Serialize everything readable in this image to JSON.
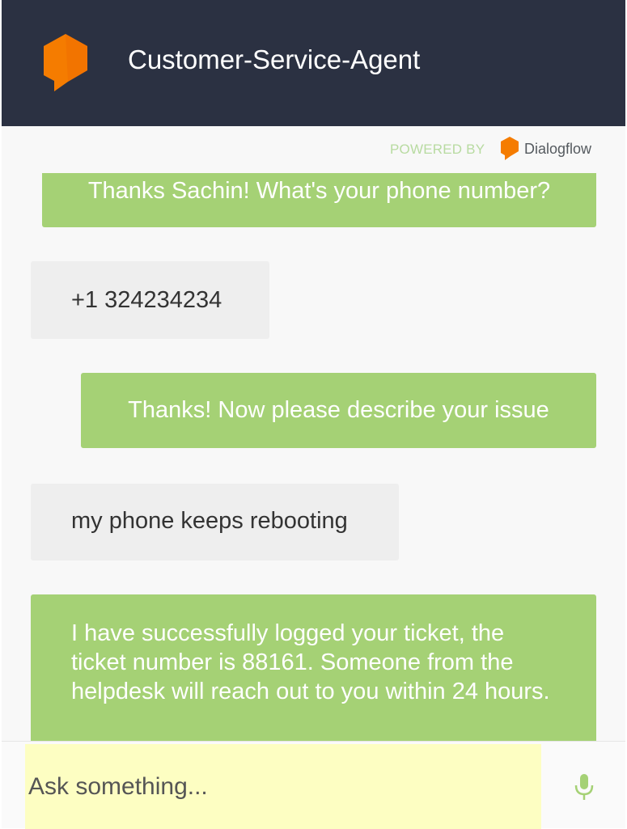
{
  "header": {
    "title": "Customer-Service-Agent",
    "logo_icon": "speech-bubble-logo-icon",
    "background": "#2b3142"
  },
  "powered_by": {
    "label": "POWERED BY",
    "brand": "Dialogflow",
    "brand_icon": "dialogflow-logo-icon"
  },
  "messages": [
    {
      "sender": "bot",
      "text": "Thanks Sachin! What's your phone number?"
    },
    {
      "sender": "user",
      "text": "+1 324234234"
    },
    {
      "sender": "bot",
      "text": "Thanks! Now please describe your issue"
    },
    {
      "sender": "user",
      "text": "my phone keeps rebooting"
    },
    {
      "sender": "bot",
      "text": "I have successfully logged your ticket, the ticket number is 88161. Someone from the helpdesk will reach out to you within 24 hours."
    }
  ],
  "input": {
    "placeholder": "Ask something...",
    "value": ""
  },
  "mic_icon": "microphone-icon",
  "colors": {
    "accent": "#f57c00",
    "bot_bubble": "#a5d175",
    "user_bubble": "#eeeeee",
    "input_highlight": "#fdfec2"
  }
}
